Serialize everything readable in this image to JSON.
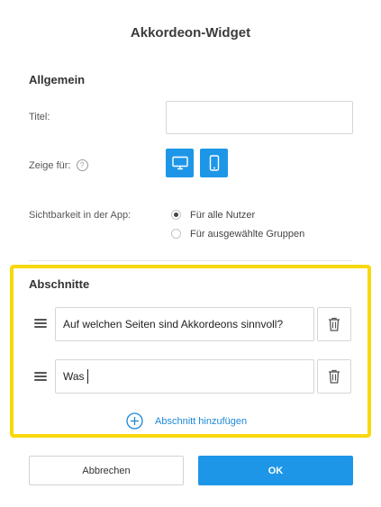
{
  "dialog": {
    "title": "Akkordeon-Widget"
  },
  "general": {
    "heading": "Allgemein",
    "title_label": "Titel:",
    "title_value": "",
    "show_for_label": "Zeige für:",
    "help_icon_glyph": "?",
    "devices": [
      {
        "name": "desktop",
        "icon": "monitor-icon",
        "active": true
      },
      {
        "name": "mobile",
        "icon": "phone-icon",
        "active": true
      }
    ],
    "visibility_label": "Sichtbarkeit in der App:",
    "visibility_options": [
      {
        "label": "Für alle Nutzer",
        "selected": true
      },
      {
        "label": "Für ausgewählte Gruppen",
        "selected": false
      }
    ]
  },
  "sections": {
    "heading": "Abschnitte",
    "items": [
      {
        "value": "Auf welchen Seiten sind Akkordeons sinnvoll?"
      },
      {
        "value": "Was"
      }
    ],
    "add_label": "Abschnitt hinzufügen"
  },
  "footer": {
    "cancel_label": "Abbrechen",
    "ok_label": "OK"
  },
  "colors": {
    "accent": "#1e96e8",
    "highlight": "#f8d80c",
    "link": "#1e88d8"
  }
}
